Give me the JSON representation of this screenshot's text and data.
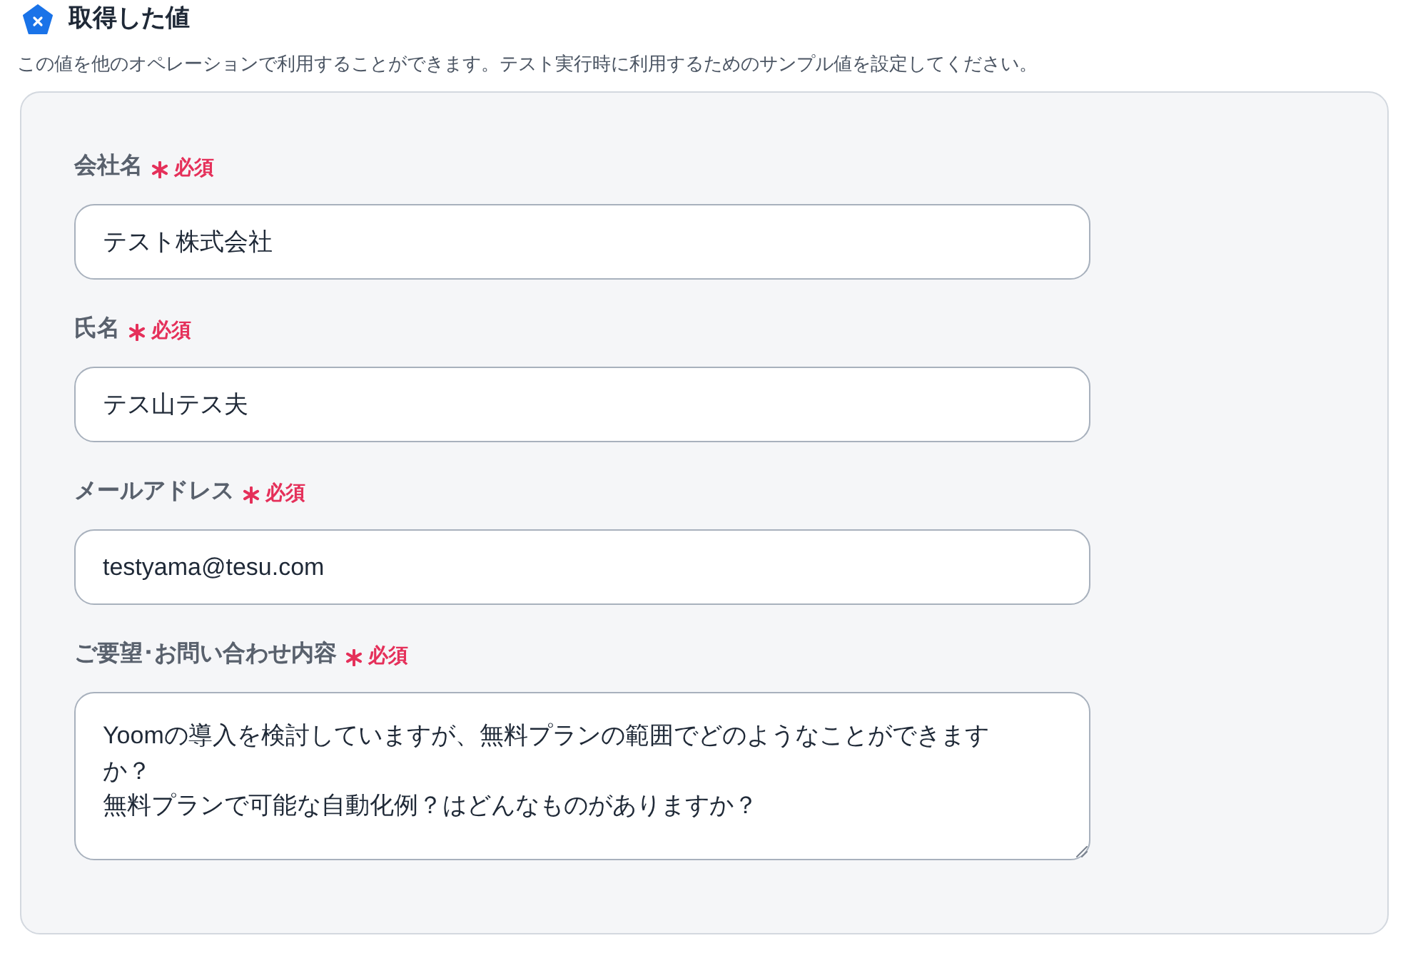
{
  "header": {
    "title": "取得した値",
    "description": "この値を他のオペレーションで利用することができます。テスト実行時に利用するためのサンプル値を設定してください。"
  },
  "fields": [
    {
      "kind": "input",
      "label": "会社名",
      "required_badge": "必須",
      "value": "テスト株式会社"
    },
    {
      "kind": "input",
      "label": "氏名",
      "required_badge": "必須",
      "value": "テス山テス夫"
    },
    {
      "kind": "input",
      "label": "メールアドレス",
      "required_badge": "必須",
      "value": "testyama@tesu.com"
    },
    {
      "kind": "textarea",
      "label": "ご要望･お問い合わせ内容",
      "required_badge": "必須",
      "value_lines": [
        "Yoomの導入を検討していますが、無料プランの範囲でどのようなことができますか？",
        "無料プランで可能な自動化例？はどんなものがありますか？"
      ]
    }
  ]
}
